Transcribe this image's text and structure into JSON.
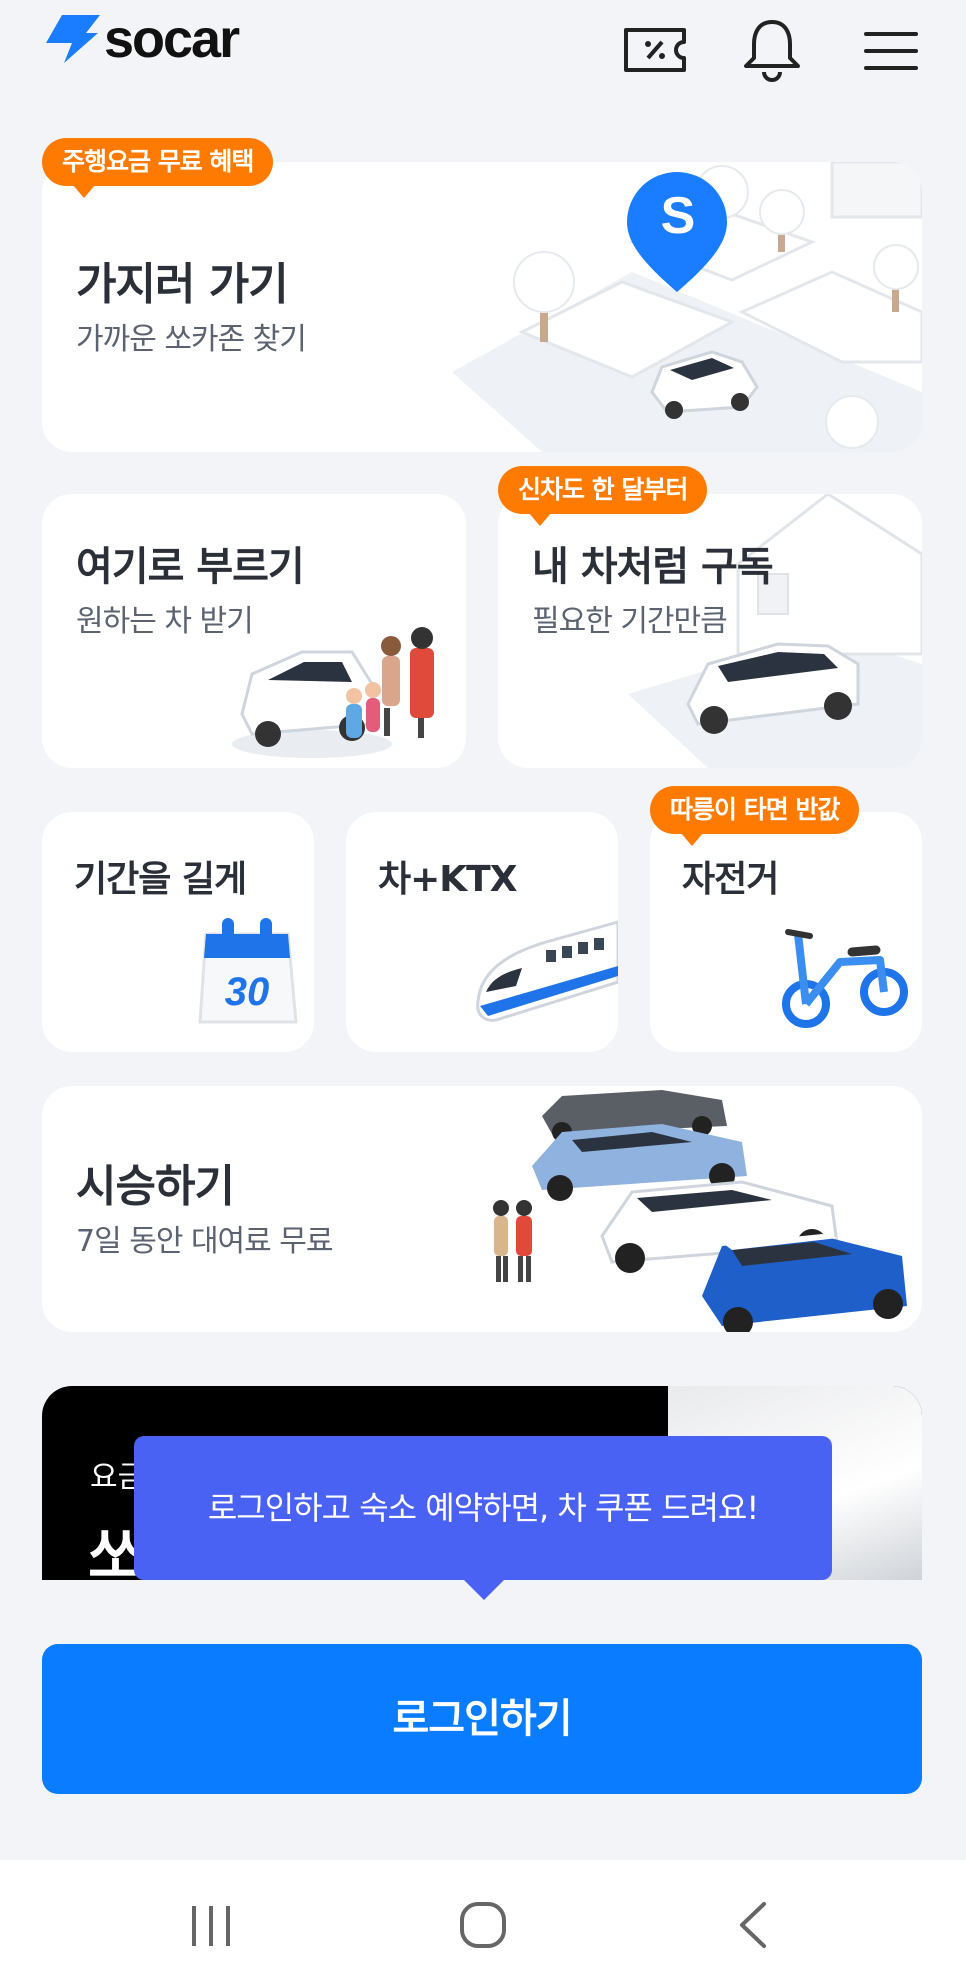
{
  "header": {
    "logo": "socar"
  },
  "cards": {
    "go": {
      "badge": "주행요금 무료 혜택",
      "title": "가지러 가기",
      "subtitle": "가까운 쏘카존 찾기",
      "pin_letter": "S"
    },
    "call": {
      "title": "여기로 부르기",
      "subtitle": "원하는 차 받기"
    },
    "subscribe": {
      "badge": "신차도 한 달부터",
      "title": "내 차처럼 구독",
      "subtitle": "필요한 기간만큼"
    },
    "long": {
      "title": "기간을 길게",
      "calendar_number": "30"
    },
    "ktx": {
      "title": "차+KTX"
    },
    "bike": {
      "badge": "따릉이 타면 반값",
      "title": "자전거"
    },
    "test": {
      "title": "시승하기",
      "subtitle": "7일 동안 대여료 무료"
    }
  },
  "banner": {
    "partial_text_1": "요금",
    "partial_text_2": "쏘"
  },
  "tooltip": {
    "text": "로그인하고 숙소 예약하면, 차 쿠폰 드려요!"
  },
  "login_button": {
    "label": "로그인하기"
  },
  "colors": {
    "brand": "#0a7cff",
    "badge": "#ff7a00",
    "tooltip": "#4a62f3"
  }
}
